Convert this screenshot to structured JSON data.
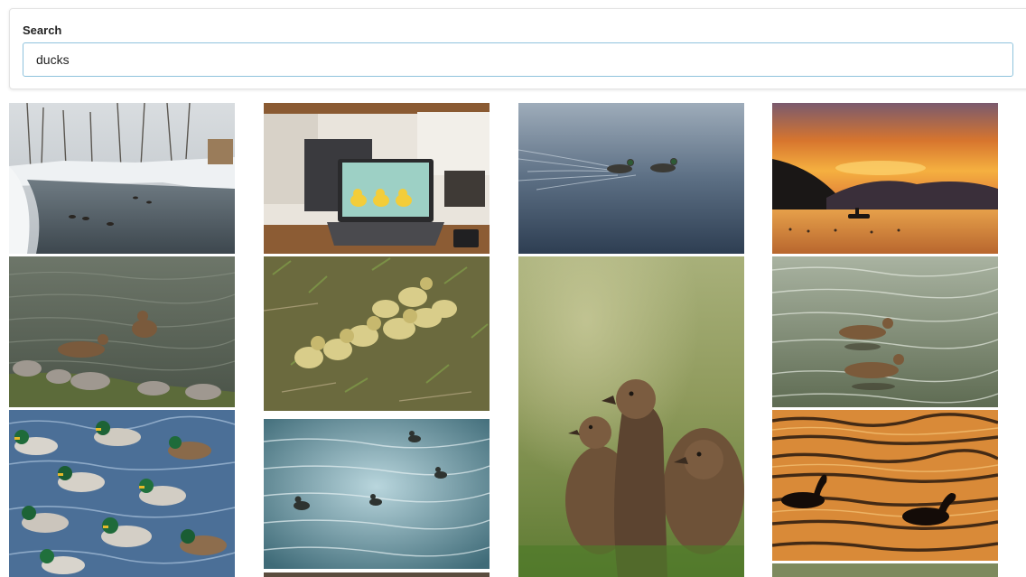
{
  "search": {
    "label": "Search",
    "value": "ducks"
  },
  "results": [
    {
      "name": "snowy-river-ducks",
      "icon": "photo-thumbnail"
    },
    {
      "name": "laptop-rubber-ducks",
      "icon": "photo-thumbnail"
    },
    {
      "name": "two-ducks-swimming",
      "icon": "photo-thumbnail"
    },
    {
      "name": "sunset-lake-boat",
      "icon": "photo-thumbnail"
    },
    {
      "name": "ducks-by-shore",
      "icon": "photo-thumbnail"
    },
    {
      "name": "ducklings-in-grass",
      "icon": "photo-thumbnail"
    },
    {
      "name": "ducklings-closeup",
      "icon": "photo-thumbnail"
    },
    {
      "name": "two-ducks-green-water",
      "icon": "photo-thumbnail"
    },
    {
      "name": "mallard-flock",
      "icon": "photo-thumbnail"
    },
    {
      "name": "ducks-rippled-water",
      "icon": "photo-thumbnail"
    },
    {
      "name": "duck-silhouettes-golden-water",
      "icon": "photo-thumbnail"
    }
  ]
}
